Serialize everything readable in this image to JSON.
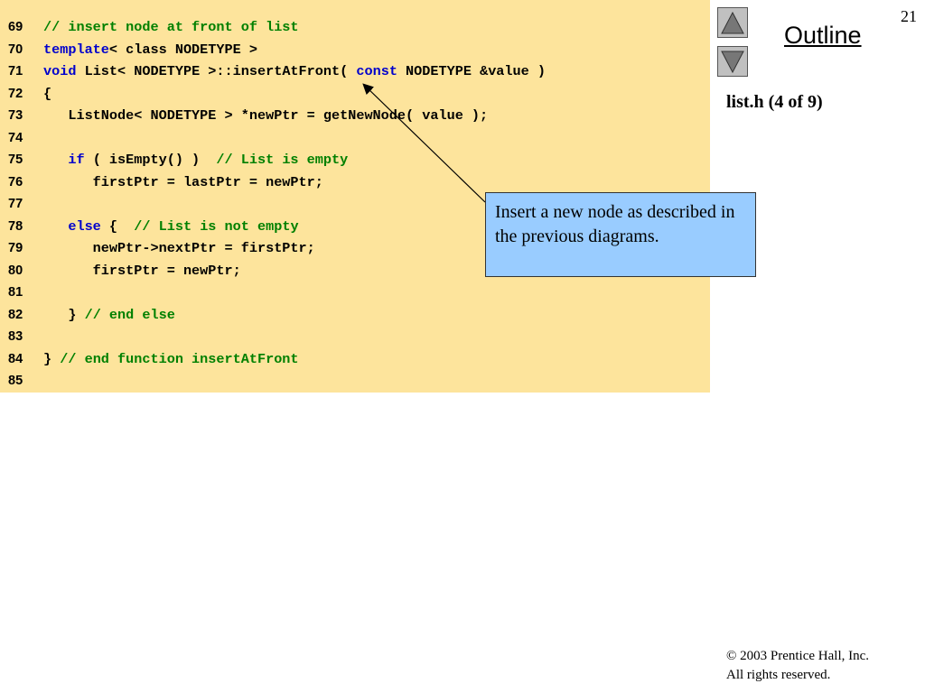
{
  "slide": {
    "number": "21",
    "outline_label": "Outline",
    "subtitle": "list.h (4 of 9)",
    "callout_text": "Insert a new node as described in the previous diagrams.",
    "footer_copyright": "© 2003 Prentice Hall, Inc.",
    "footer_rights": "All rights reserved."
  },
  "nav": {
    "up_icon": "triangle-up-icon",
    "down_icon": "triangle-down-icon"
  },
  "colors": {
    "code_background": "#fde49c",
    "keyword": "#0000cc",
    "comment": "#008000",
    "callout_background": "#99ccff"
  },
  "code": [
    {
      "num": "69",
      "segments": [
        {
          "t": "// insert node at front of list",
          "k": "cm"
        }
      ]
    },
    {
      "num": "70",
      "segments": [
        {
          "t": "template",
          "k": "kw"
        },
        {
          "t": "< class NODETYPE >",
          "k": "tx"
        }
      ]
    },
    {
      "num": "71",
      "segments": [
        {
          "t": "void",
          "k": "kw"
        },
        {
          "t": " List< NODETYPE >::insertAtFront( ",
          "k": "tx"
        },
        {
          "t": "const",
          "k": "kw"
        },
        {
          "t": " NODETYPE &value )",
          "k": "tx"
        }
      ]
    },
    {
      "num": "72",
      "segments": [
        {
          "t": "{",
          "k": "tx"
        }
      ]
    },
    {
      "num": "73",
      "segments": [
        {
          "t": "   ListNode< NODETYPE > *newPtr = getNewNode( value );",
          "k": "tx"
        }
      ]
    },
    {
      "num": "74",
      "segments": []
    },
    {
      "num": "75",
      "segments": [
        {
          "t": "   ",
          "k": "tx"
        },
        {
          "t": "if",
          "k": "kw"
        },
        {
          "t": " ( isEmpty() )  ",
          "k": "tx"
        },
        {
          "t": "// List is empty",
          "k": "cm"
        }
      ]
    },
    {
      "num": "76",
      "segments": [
        {
          "t": "      firstPtr = lastPtr = newPtr;",
          "k": "tx"
        }
      ]
    },
    {
      "num": "77",
      "segments": []
    },
    {
      "num": "78",
      "segments": [
        {
          "t": "   ",
          "k": "tx"
        },
        {
          "t": "else",
          "k": "kw"
        },
        {
          "t": " {  ",
          "k": "tx"
        },
        {
          "t": "// List is not empty",
          "k": "cm"
        }
      ]
    },
    {
      "num": "79",
      "segments": [
        {
          "t": "      newPtr->nextPtr = firstPtr;",
          "k": "tx"
        }
      ]
    },
    {
      "num": "80",
      "segments": [
        {
          "t": "      firstPtr = newPtr;",
          "k": "tx"
        }
      ]
    },
    {
      "num": "81",
      "segments": []
    },
    {
      "num": "82",
      "segments": [
        {
          "t": "   } ",
          "k": "tx"
        },
        {
          "t": "// end else",
          "k": "cm"
        }
      ]
    },
    {
      "num": "83",
      "segments": []
    },
    {
      "num": "84",
      "segments": [
        {
          "t": "} ",
          "k": "tx"
        },
        {
          "t": "// end function insertAtFront",
          "k": "cm"
        }
      ]
    },
    {
      "num": "85",
      "segments": []
    }
  ]
}
